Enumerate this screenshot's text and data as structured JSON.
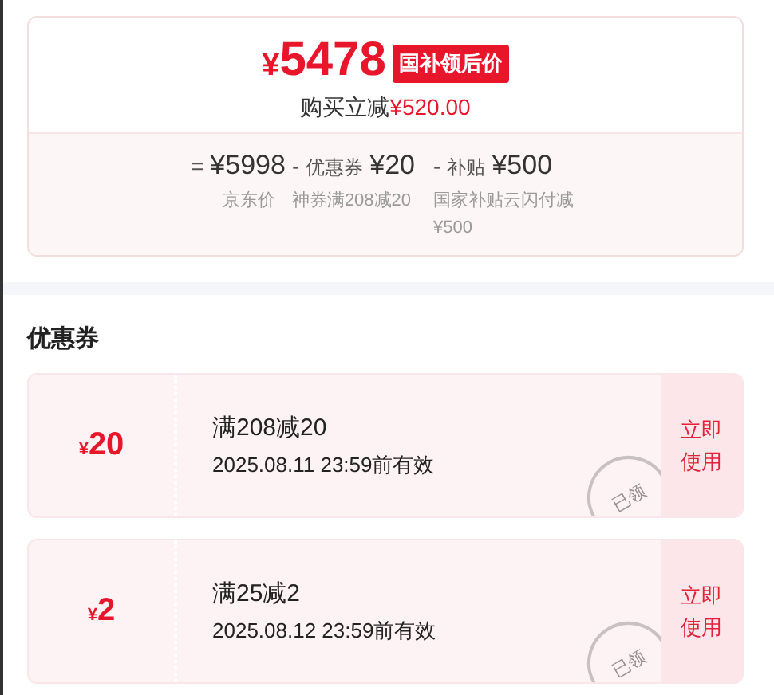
{
  "price_card": {
    "currency": "¥",
    "price": "5478",
    "badge": "国补领后价",
    "discount_label": "购买立减",
    "discount_amount": "¥520.00",
    "breakdown": [
      {
        "operator": "=",
        "amount": "¥5998",
        "description": "京东价"
      },
      {
        "operator": "-",
        "label": "优惠券",
        "amount": "¥20",
        "description": "神券满208减20"
      },
      {
        "operator": "-",
        "label": "补贴",
        "amount": "¥500",
        "description": "国家补贴云闪付减¥500"
      }
    ]
  },
  "coupons_section": {
    "title": "优惠券",
    "coupons": [
      {
        "currency": "¥",
        "value": "20",
        "condition": "满208减20",
        "validity": "2025.08.11 23:59前有效",
        "stamp": "已领",
        "action": "立即使用"
      },
      {
        "currency": "¥",
        "value": "2",
        "condition": "满25减2",
        "validity": "2025.08.12 23:59前有效",
        "stamp": "已领",
        "action": "立即使用"
      }
    ]
  }
}
